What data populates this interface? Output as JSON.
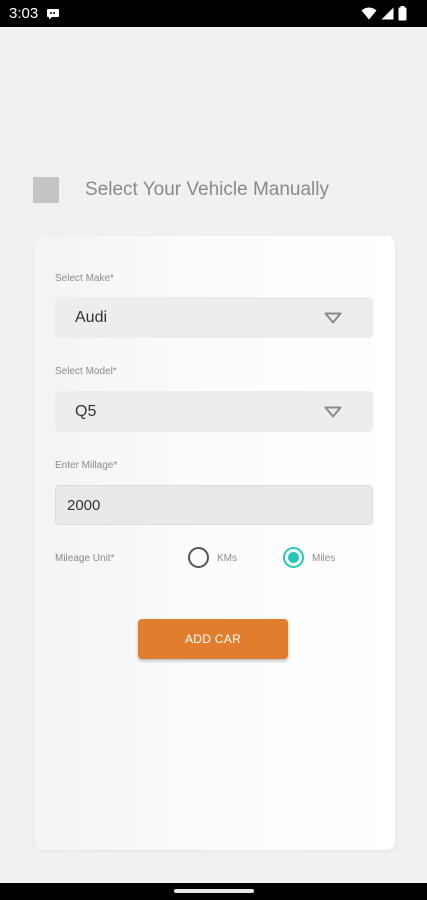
{
  "status_bar": {
    "time": "3:03"
  },
  "manual_select": {
    "label": "Select Your Vehicle Manually"
  },
  "form": {
    "make": {
      "label": "Select Make*",
      "value": "Audi"
    },
    "model": {
      "label": "Select Model*",
      "value": "Q5"
    },
    "mileage": {
      "label": "Enter Millage*",
      "value": "2000"
    },
    "unit": {
      "label": "Mileage Unit*",
      "options": [
        "KMs",
        "Miles"
      ],
      "selected": "Miles"
    },
    "submit_label": "ADD CAR"
  },
  "colors": {
    "accent": "#e07e2e",
    "radio_active": "#26c6b9"
  }
}
